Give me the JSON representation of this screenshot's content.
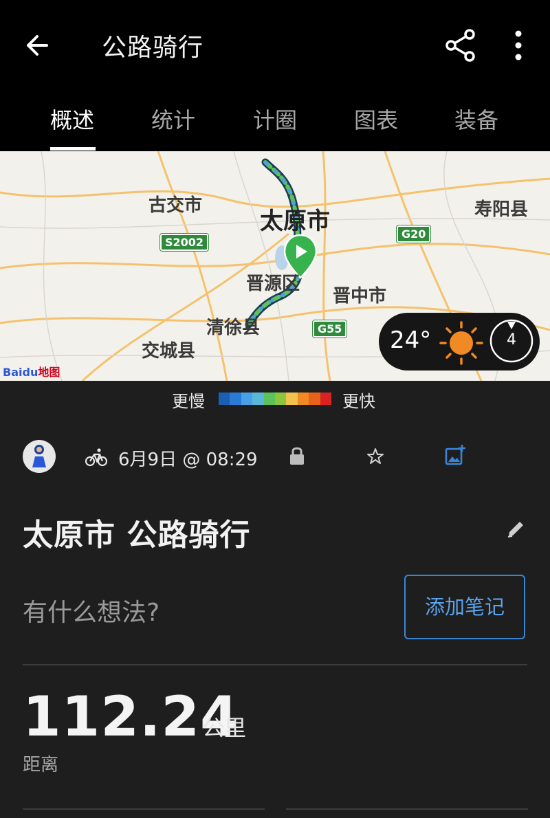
{
  "header": {
    "title": "公路骑行",
    "tabs": [
      "概述",
      "统计",
      "计圈",
      "图表",
      "装备"
    ],
    "active_tab": "概述"
  },
  "map": {
    "places": {
      "gujiao": "古交市",
      "taiyuan": "太原市",
      "shouyang": "寿阳县",
      "jinyuan": "晋源区",
      "jinzhong": "晋中市",
      "qingxu": "清徐县",
      "jiaocheng": "交城县"
    },
    "shields": {
      "s2002": "S2002",
      "g20": "G20",
      "g55": "G55"
    },
    "provider": {
      "brand": "Bai",
      "brand2": "du",
      "suffix": "地图"
    },
    "weather": {
      "temperature": "24°",
      "uv_index": "4"
    }
  },
  "legend": {
    "slow_label": "更慢",
    "fast_label": "更快",
    "colors": [
      "#1a5fb4",
      "#2a7bd6",
      "#4aa0e6",
      "#59b8d8",
      "#5cc25a",
      "#8cc63f",
      "#f2c14e",
      "#f08a24",
      "#e8621c",
      "#d92323"
    ]
  },
  "activity": {
    "date": "6月9日 @ 08:29",
    "title": "太原市 公路骑行",
    "thoughts_placeholder": "有什么想法?",
    "add_note_label": "添加笔记",
    "distance_value": "112.24",
    "distance_unit": "公里",
    "distance_label": "距离"
  },
  "colors": {
    "accent": "#3a86d6",
    "background": "#1e1e1e",
    "topbar": "#000000"
  }
}
